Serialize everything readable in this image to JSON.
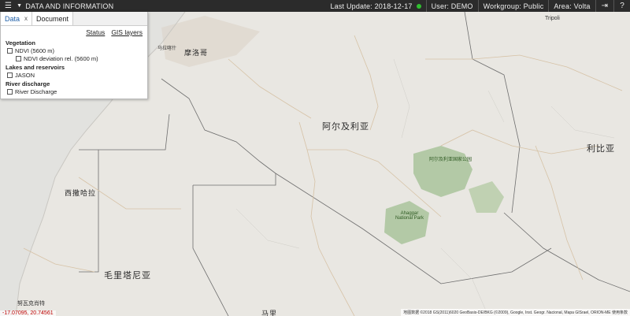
{
  "topbar": {
    "title": "DATA AND INFORMATION",
    "last_update": "Last Update: 2018-12-17",
    "user": "User: DEMO",
    "workgroup": "Workgroup: Public",
    "area": "Area: Volta",
    "status_color": "#30c030"
  },
  "panel": {
    "tab_data": "Data",
    "tab_data_close": "x",
    "tab_document": "Document",
    "link_status": "Status",
    "link_gis": "GIS layers",
    "groups": {
      "vegetation": "Vegetation",
      "ndvi": "NDVI (5600 m)",
      "ndvi_dev": "NDVI deviation rel. (5600 m)",
      "lakes": "Lakes and reservoirs",
      "jason": "JASON",
      "river": "River discharge",
      "river_item": "River Discharge"
    }
  },
  "map": {
    "labels": {
      "algeria": "阿尔及利亚",
      "libya": "利比亚",
      "morocco": "摩洛哥",
      "western_sahara": "西撒哈拉",
      "mauritania": "毛里塔尼亚",
      "tripoli": "Tripoli",
      "national_park": "阿尔及利亚国家公园",
      "ahaggar": "Ahaggar National Park",
      "rabat": "马拉喀什",
      "nouakchott": "努瓦克肖特",
      "mali": "马里"
    },
    "coords": "-17.07095, 20.74561",
    "attribution": "地图数据 ©2018 GS(2011)6020 GeoBasis-DE/BKG (©2009), Google, Inst. Geogr. Nacional, Mapa GISrael, ORION-ME   使用条款"
  }
}
